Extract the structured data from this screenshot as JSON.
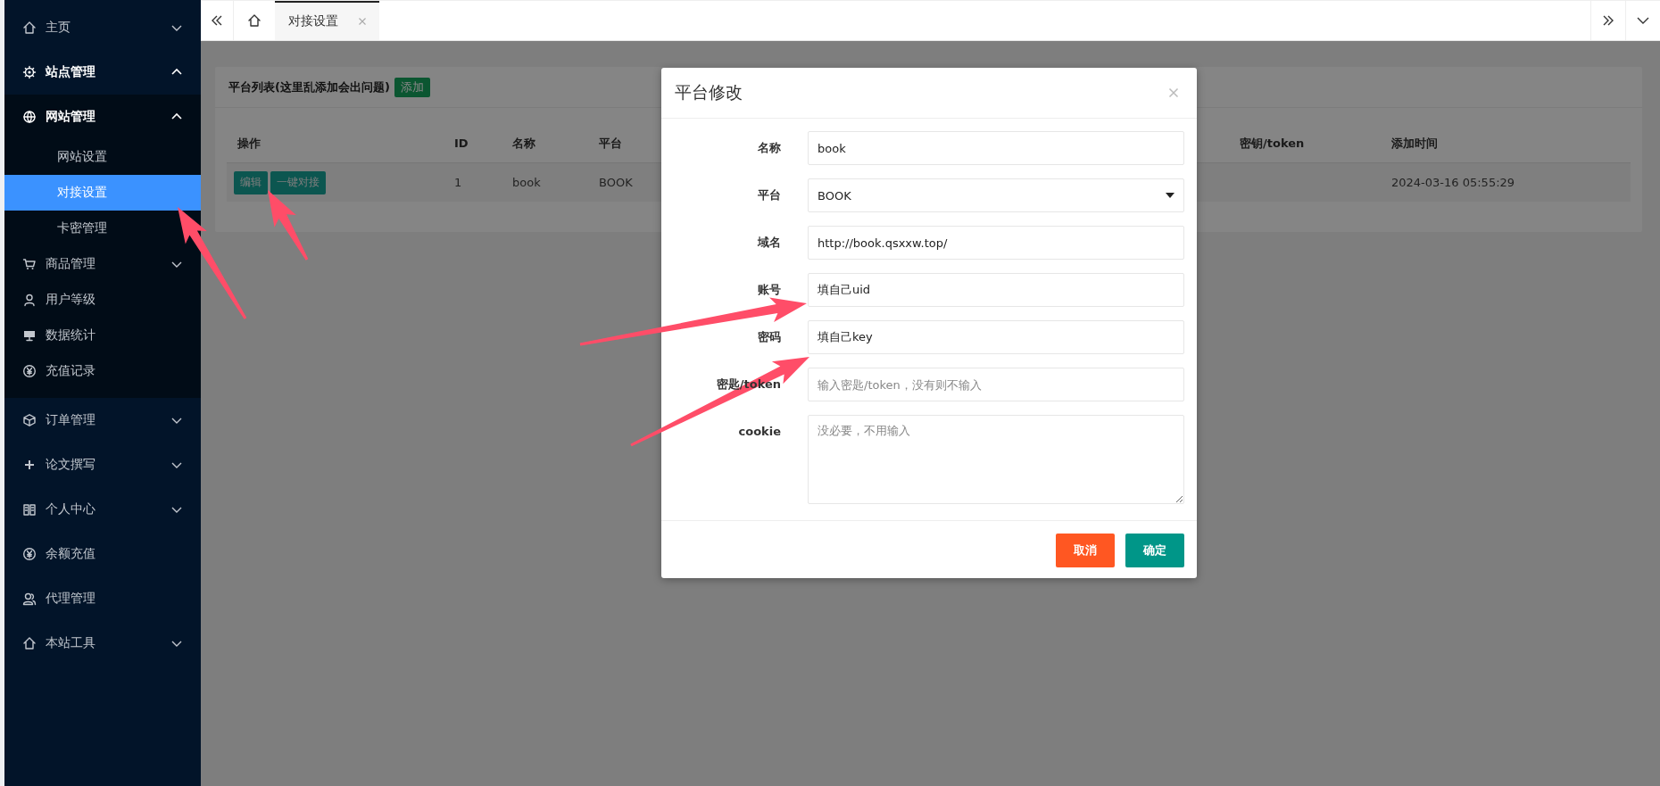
{
  "sidebar": {
    "items": [
      {
        "label": "主页",
        "expanded": false
      },
      {
        "label": "站点管理",
        "expanded": true,
        "children": [
          {
            "label": "网站管理",
            "expanded": true,
            "children": [
              {
                "label": "网站设置",
                "selected": false
              },
              {
                "label": "对接设置",
                "selected": true
              },
              {
                "label": "卡密管理",
                "selected": false
              }
            ]
          },
          {
            "label": "商品管理",
            "expanded": false
          },
          {
            "label": "用户等级"
          },
          {
            "label": "数据统计"
          },
          {
            "label": "充值记录"
          }
        ]
      },
      {
        "label": "订单管理",
        "expanded": false
      },
      {
        "label": "论文撰写",
        "expanded": false
      },
      {
        "label": "个人中心",
        "expanded": false
      },
      {
        "label": "余额充值"
      },
      {
        "label": "代理管理"
      },
      {
        "label": "本站工具",
        "expanded": false
      }
    ]
  },
  "tabs": [
    {
      "label": "对接设置",
      "selected": true
    }
  ],
  "card": {
    "title": "平台列表(这里乱添加会出问题)",
    "add_button": "添加",
    "table": {
      "columns": [
        "操作",
        "ID",
        "名称",
        "平台",
        "密钥/token",
        "添加时间"
      ],
      "rows": [
        {
          "actions": [
            "编辑",
            "一键对接"
          ],
          "cells": [
            "",
            "1",
            "book",
            "BOOK",
            "",
            "2024-03-16 05:55:29"
          ]
        }
      ]
    }
  },
  "modal": {
    "title": "平台修改",
    "fields": [
      {
        "kind": "input",
        "label": "名称",
        "value": "book"
      },
      {
        "kind": "select",
        "label": "平台",
        "value": "BOOK"
      },
      {
        "kind": "input",
        "label": "域名",
        "value": "http://book.qsxxw.top/"
      },
      {
        "kind": "input",
        "label": "账号",
        "value": "填自己uid"
      },
      {
        "kind": "input",
        "label": "密码",
        "value": "填自己key"
      },
      {
        "kind": "input",
        "label": "密匙/token",
        "placeholder": "输入密匙/token，没有则不输入"
      },
      {
        "kind": "textarea",
        "label": "cookie",
        "placeholder": "没必要，不用输入"
      }
    ],
    "buttons": [
      {
        "label": "取消",
        "kind": "cancel"
      },
      {
        "label": "确定",
        "kind": "confirm"
      }
    ]
  }
}
